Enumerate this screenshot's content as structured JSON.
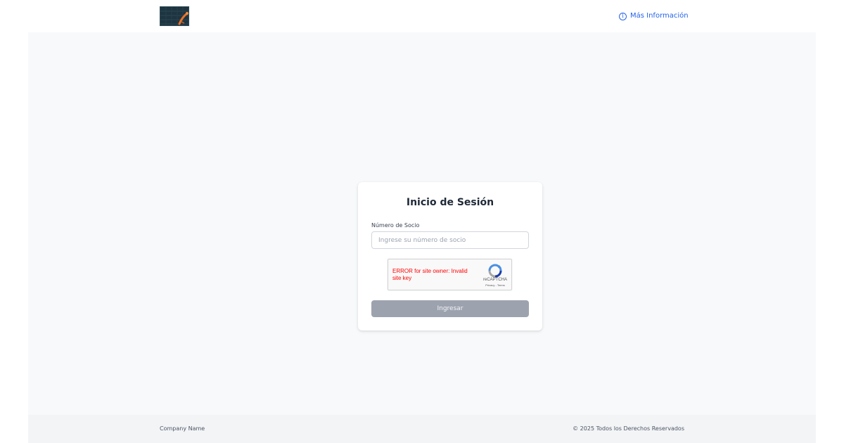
{
  "header": {
    "logo_icon": "company-logo",
    "info_link": {
      "icon": "info-circle-icon",
      "label": "Más Información",
      "color": "#2563eb"
    }
  },
  "login": {
    "title": "Inicio de Sesión",
    "member_field": {
      "label": "Número de Socio",
      "placeholder": "Ingrese su número de socio",
      "value": ""
    },
    "recaptcha": {
      "error": "ERROR for site owner: Invalid site key",
      "brand": "reCAPTCHA",
      "terms": "Privacy - Terms",
      "error_color": "#ff0000"
    },
    "submit_label": "Ingresar",
    "submit_color": "#9ca3af"
  },
  "footer": {
    "company": "Company Name",
    "copyright": "© 2025 Todos los Derechos Reservados"
  }
}
